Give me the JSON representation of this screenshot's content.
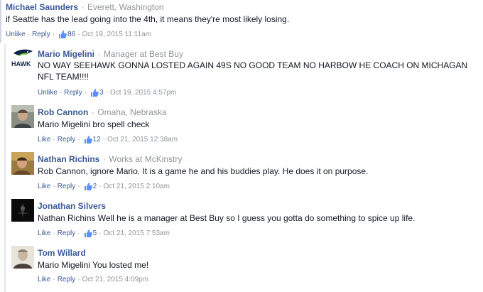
{
  "sep": "·",
  "comments": [
    {
      "author": "Michael Saunders",
      "meta": "Everett, Washington",
      "text": "if Seattle has the lead going into the 4th, it means they're most likely losing.",
      "action": "Unlike",
      "reply": "Reply",
      "likes": "86",
      "time": "Oct 19, 2015 11:11am"
    },
    {
      "author": "Mario Migelini",
      "meta": "Manager at Best Buy",
      "text": "NO WAY SEEHAWK GONNA LOSTED AGAIN 49S NO GOOD TEAM NO HARBOW HE COACH ON MICHAGAN NFL TEAM!!!!",
      "action": "Unlike",
      "reply": "Reply",
      "likes": "3",
      "time": "Oct 19, 2015 4:57pm",
      "avatar_text": "HAWK"
    },
    {
      "author": "Rob Cannon",
      "meta": "Omaha, Nebraska",
      "text": "Mario Migelini bro spell check",
      "action": "Like",
      "reply": "Reply",
      "likes": "12",
      "time": "Oct 21, 2015 12:38am"
    },
    {
      "author": "Nathan Richins",
      "meta": "Works at McKinstry",
      "text": "Rob Cannon, ignore Mario. It is a game he and his buddies play. He does it on purpose.",
      "action": "Like",
      "reply": "Reply",
      "likes": "2",
      "time": "Oct 21, 2015 2:10am"
    },
    {
      "author": "Jonathan Silvers",
      "meta": "",
      "text": "Nathan Richins Well he is a manager at Best Buy so I guess you gotta do something to spice up life.",
      "action": "Like",
      "reply": "Reply",
      "likes": "5",
      "time": "Oct 21, 2015 7:53am"
    },
    {
      "author": "Tom Willard",
      "meta": "",
      "text": "Mario Migelini You losted me!",
      "action": "Like",
      "reply": "Reply",
      "likes": "",
      "time": "Oct 21, 2015 4:09pm"
    }
  ],
  "colors": {
    "link": "#3b5998",
    "meta": "#90949c",
    "text": "#141823"
  }
}
